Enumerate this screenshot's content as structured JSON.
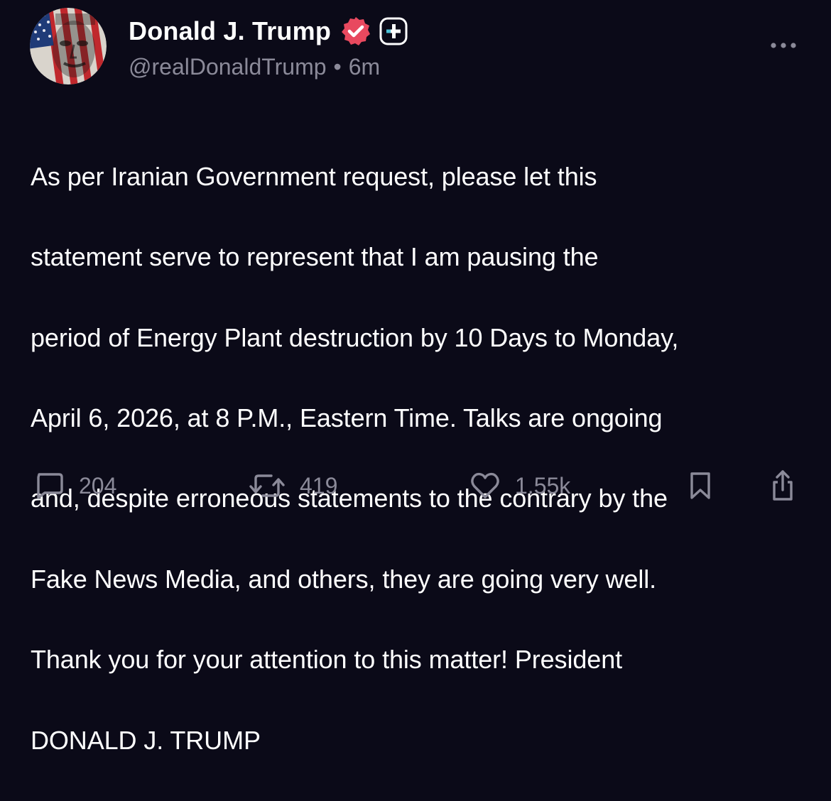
{
  "post": {
    "author": {
      "display_name": "Donald J. Trump",
      "handle": "@realDonaldTrump",
      "separator": "•",
      "time_ago": "6m",
      "avatar_icon": "flag-face-avatar",
      "verified_icon": "verified-badge-icon",
      "plus_icon": "plus-badge-icon"
    },
    "body_lines": [
      "As per Iranian Government request, please let this",
      "statement serve to represent that I am pausing the",
      "period of Energy Plant destruction by 10 Days to Monday,",
      "April 6, 2026, at 8 P.M., Eastern Time. Talks are ongoing",
      "and, despite erroneous statements to the contrary by the",
      "Fake News Media, and others, they are going very well.",
      "Thank you for your attention to this matter! President",
      "DONALD J. TRUMP"
    ],
    "actions": {
      "replies": "204",
      "reposts": "419",
      "likes": "1.55k",
      "reply_icon": "comment-icon",
      "repost_icon": "repost-icon",
      "like_icon": "heart-icon",
      "bookmark_icon": "bookmark-icon",
      "share_icon": "share-icon",
      "more_icon": "more-dots-icon"
    }
  },
  "colors": {
    "background": "#0b0a18",
    "text_primary": "#ffffff",
    "text_secondary": "#8b8a99",
    "verified_badge": "#e8495f"
  }
}
